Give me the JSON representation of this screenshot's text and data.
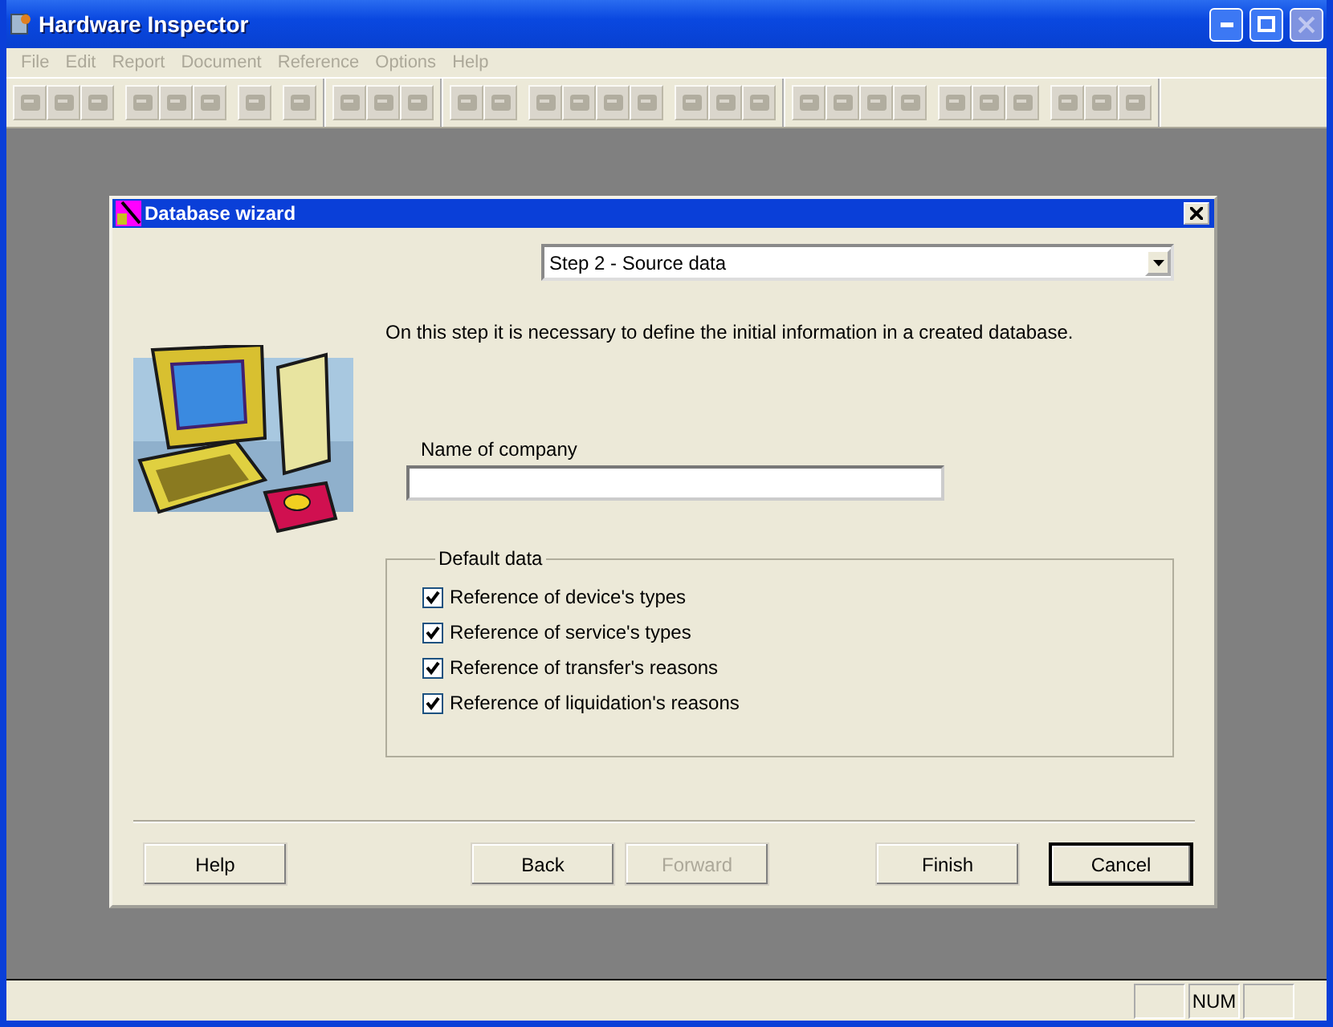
{
  "window": {
    "title": "Hardware Inspector"
  },
  "menu": [
    {
      "label": "File",
      "disabled": true
    },
    {
      "label": "Edit",
      "disabled": true
    },
    {
      "label": "Report",
      "disabled": true
    },
    {
      "label": "Document",
      "disabled": true
    },
    {
      "label": "Reference",
      "disabled": true
    },
    {
      "label": "Options",
      "disabled": true
    },
    {
      "label": "Help",
      "disabled": true
    }
  ],
  "toolbar": {
    "groups": [
      {
        "clusters": [
          {
            "buttons": [
              {
                "disabled": true
              },
              {
                "disabled": true
              },
              {
                "disabled": true
              }
            ]
          },
          {
            "buttons": [
              {
                "disabled": true
              },
              {
                "disabled": true
              },
              {
                "disabled": true
              }
            ]
          },
          {
            "buttons": [
              {
                "disabled": true
              }
            ]
          },
          {
            "buttons": [
              {
                "disabled": true
              }
            ]
          }
        ]
      },
      {
        "clusters": [
          {
            "buttons": [
              {
                "disabled": true
              },
              {
                "disabled": true
              },
              {
                "disabled": true
              }
            ]
          }
        ]
      },
      {
        "clusters": [
          {
            "buttons": [
              {
                "disabled": true
              },
              {
                "disabled": true
              }
            ]
          },
          {
            "buttons": [
              {
                "disabled": true
              },
              {
                "disabled": true
              },
              {
                "disabled": true
              },
              {
                "disabled": true
              }
            ]
          },
          {
            "buttons": [
              {
                "disabled": true
              },
              {
                "disabled": true
              },
              {
                "disabled": true
              }
            ]
          }
        ]
      },
      {
        "clusters": [
          {
            "buttons": [
              {
                "disabled": true
              },
              {
                "disabled": true
              },
              {
                "disabled": true
              },
              {
                "disabled": true
              }
            ]
          },
          {
            "buttons": [
              {
                "disabled": true
              },
              {
                "disabled": true
              },
              {
                "disabled": true
              }
            ]
          },
          {
            "buttons": [
              {
                "disabled": true
              },
              {
                "disabled": true
              },
              {
                "disabled": true
              }
            ]
          }
        ]
      }
    ]
  },
  "dialog": {
    "title": "Database wizard",
    "step": "Step 2 - Source data",
    "description": "On this step it is necessary to define the initial information in a created database.",
    "company_field": {
      "label": "Name of company"
    },
    "default_data": {
      "legend": "Default data",
      "options": [
        {
          "label": "Reference of device's types",
          "checked": true
        },
        {
          "label": "Reference of service's types",
          "checked": true
        },
        {
          "label": "Reference of transfer's reasons",
          "checked": true
        },
        {
          "label": "Reference of liquidation's reasons",
          "checked": true
        }
      ]
    },
    "buttons": [
      {
        "label": "Help",
        "disabled": false,
        "default": false
      },
      {
        "label": "Back",
        "disabled": false,
        "default": false
      },
      {
        "label": "Forward",
        "disabled": true,
        "default": false
      },
      {
        "label": "Finish",
        "disabled": false,
        "default": false
      },
      {
        "label": "Cancel",
        "disabled": false,
        "default": true
      }
    ]
  },
  "status_bar": {
    "panels": [
      {
        "text": "NUM"
      }
    ]
  }
}
